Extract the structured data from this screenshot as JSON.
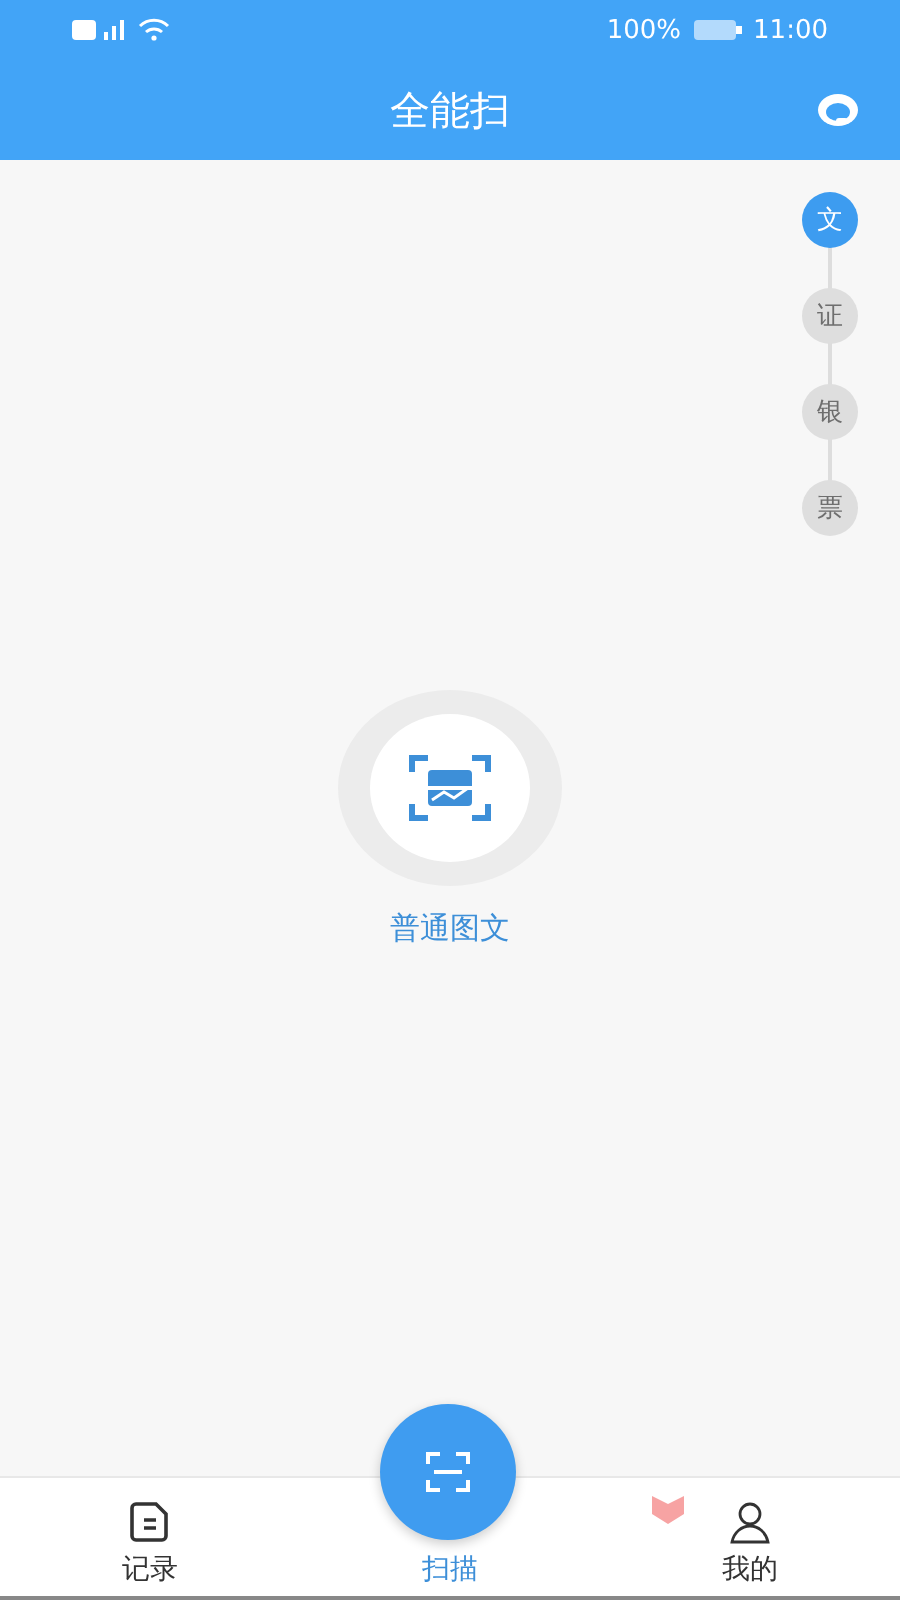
{
  "status_bar": {
    "battery": "100%",
    "time": "11:00"
  },
  "header": {
    "title": "全能扫"
  },
  "side_tabs": [
    {
      "label": "文",
      "selected": true
    },
    {
      "label": "证",
      "selected": false
    },
    {
      "label": "银",
      "selected": false
    },
    {
      "label": "票",
      "selected": false
    }
  ],
  "scan_mode": {
    "label": "普通图文"
  },
  "bottom_nav": [
    {
      "label": "记录",
      "kind": "records",
      "selected": false
    },
    {
      "label": "扫描",
      "kind": "scan",
      "selected": true
    },
    {
      "label": "我的",
      "kind": "profile",
      "selected": false
    }
  ]
}
